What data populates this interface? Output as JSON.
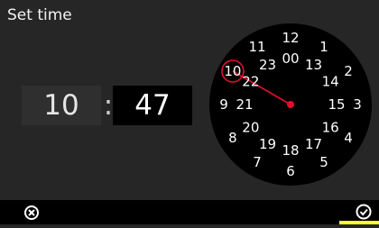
{
  "title": "Set time",
  "time": {
    "hours": "10",
    "separator": ":",
    "minutes": "47"
  },
  "dial": {
    "outer_hours": [
      "12",
      "1",
      "2",
      "3",
      "4",
      "5",
      "6",
      "7",
      "8",
      "9",
      "10",
      "11"
    ],
    "inner_hours": [
      "00",
      "13",
      "14",
      "15",
      "16",
      "17",
      "18",
      "19",
      "20",
      "21",
      "22",
      "23"
    ],
    "selected_hour": "10"
  },
  "colors": {
    "background": "#262626",
    "dial_face": "#000000",
    "accent": "#e0102a",
    "confirm_highlight": "#ffff33"
  },
  "icons": {
    "cancel": "close-circle-icon",
    "confirm": "check-circle-icon"
  }
}
